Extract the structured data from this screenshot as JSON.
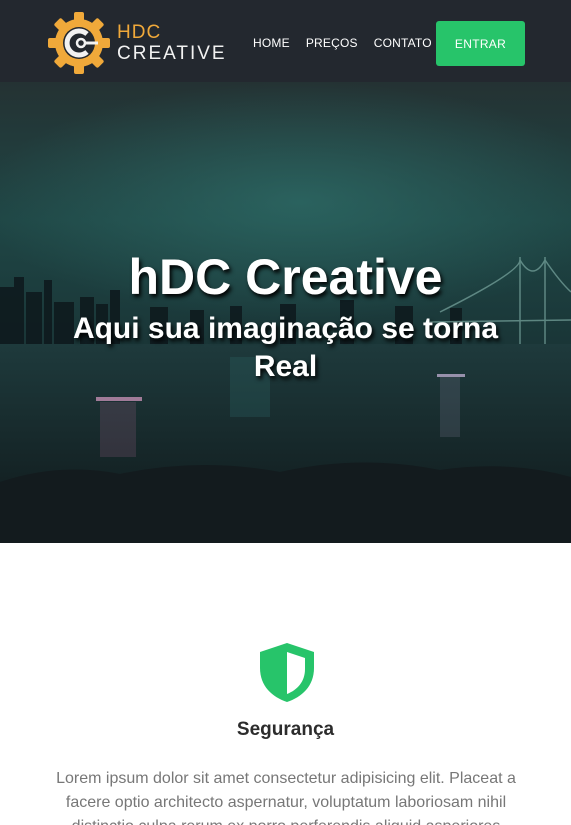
{
  "brand": {
    "line1": "HDC",
    "line2": "CREATIVE",
    "colors": {
      "accent": "#f0a93a",
      "nav_bg": "#23282f",
      "button": "#27c46a"
    }
  },
  "nav": {
    "items": [
      {
        "label": "HOME"
      },
      {
        "label": "PREÇOS"
      },
      {
        "label": "CONTATO"
      }
    ],
    "cta_label": "ENTRAR"
  },
  "hero": {
    "title": "hDC Creative",
    "subtitle": "Aqui sua imaginação se torna Real"
  },
  "feature": {
    "icon": "shield-icon",
    "icon_color": "#27c46a",
    "title": "Segurança",
    "text": "Lorem ipsum dolor sit amet consectetur adipisicing elit. Placeat a facere optio architecto aspernatur, voluptatum laboriosam nihil distinctio culpa rerum ex porro perferendis aliquid asperiores"
  }
}
